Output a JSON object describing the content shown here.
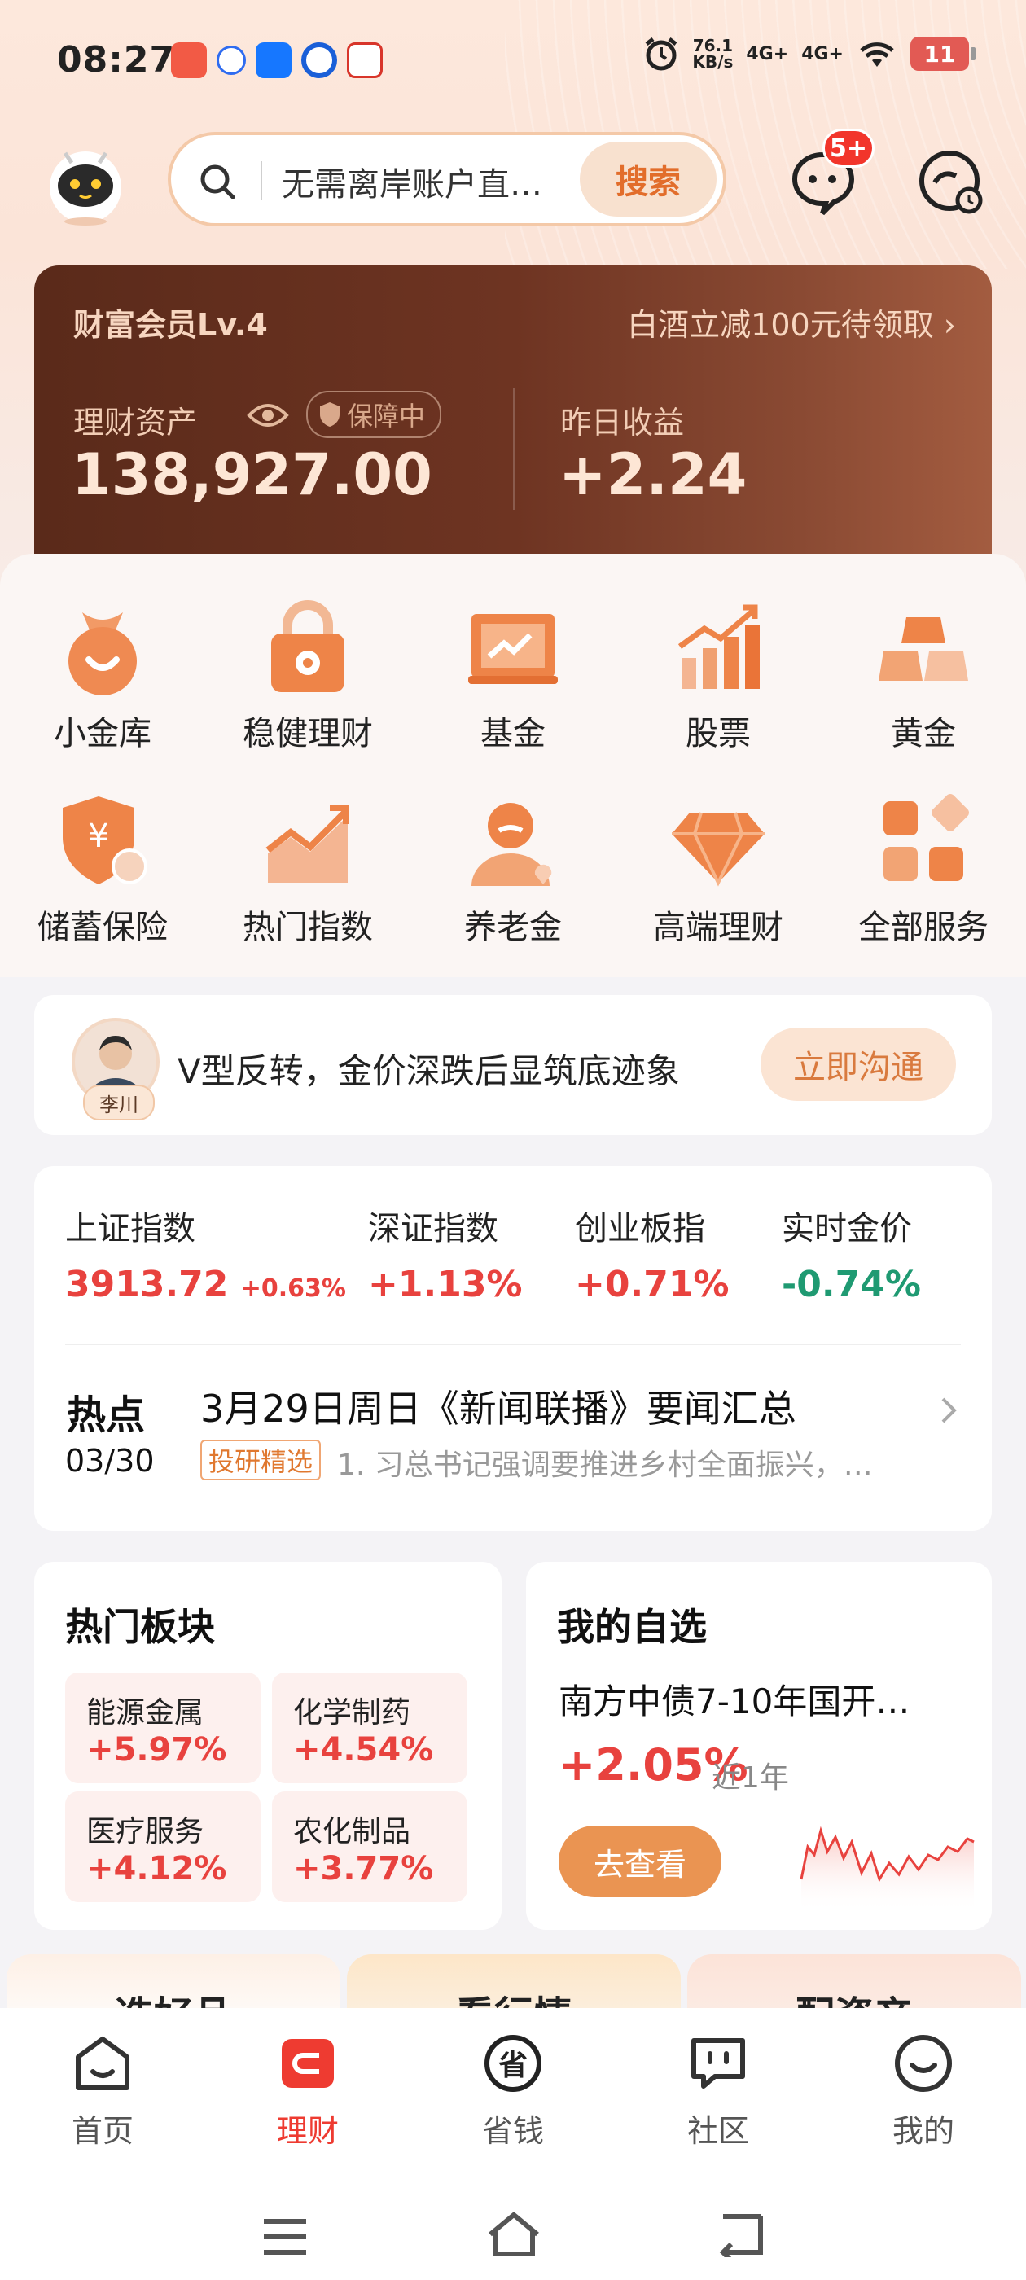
{
  "status_bar": {
    "time": "08:27",
    "net_speed_top": "76.1",
    "net_speed_unit": "KB/s",
    "signal1": "4G+",
    "signal2": "4G+",
    "battery": "11"
  },
  "header": {
    "search_placeholder": "无需离岸账户直…",
    "search_button": "搜索",
    "message_badge": "5+"
  },
  "member_card": {
    "level": "财富会员Lv.4",
    "promo": "白酒立减100元待领取",
    "asset_label": "理财资产",
    "guard_label": "保障中",
    "asset_value": "138,927.00",
    "yesterday_label": "昨日收益",
    "yesterday_value": "+2.24"
  },
  "services": [
    {
      "label": "小金库",
      "icon": "bag-icon"
    },
    {
      "label": "稳健理财",
      "icon": "lock-icon"
    },
    {
      "label": "基金",
      "icon": "board-icon"
    },
    {
      "label": "股票",
      "icon": "bar-chart-icon"
    },
    {
      "label": "黄金",
      "icon": "gold-bars-icon"
    },
    {
      "label": "储蓄保险",
      "icon": "shield-yen-icon"
    },
    {
      "label": "热门指数",
      "icon": "trend-icon"
    },
    {
      "label": "养老金",
      "icon": "elder-icon"
    },
    {
      "label": "高端理财",
      "icon": "diamond-icon"
    },
    {
      "label": "全部服务",
      "icon": "grid-icon"
    }
  ],
  "advisor": {
    "name": "李川",
    "message": "V型反转，金价深跌后显筑底迹象",
    "button": "立即沟通"
  },
  "market": {
    "indices": [
      {
        "name": "上证指数",
        "value": "3913.72",
        "change": "+0.63%"
      },
      {
        "name": "深证指数",
        "value": "+1.13%"
      },
      {
        "name": "创业板指",
        "value": "+0.71%"
      },
      {
        "name": "实时金价",
        "value": "-0.74%"
      }
    ],
    "hot_label": "热点",
    "hot_date": "03/30",
    "news_title": "3月29日周日《新闻联播》要闻汇总",
    "news_tag": "投研精选",
    "news_sub": "1. 习总书记强调要推进乡村全面振兴，…"
  },
  "sectors": {
    "title": "热门板块",
    "items": [
      {
        "name": "能源金属",
        "change": "+5.97%"
      },
      {
        "name": "化学制药",
        "change": "+4.54%"
      },
      {
        "name": "医疗服务",
        "change": "+4.12%"
      },
      {
        "name": "农化制品",
        "change": "+3.77%"
      }
    ]
  },
  "watchlist": {
    "title": "我的自选",
    "fund_name": "南方中债7-10年国开…",
    "return": "+2.05%",
    "period": "近1年",
    "button": "去查看"
  },
  "peek_tabs": [
    "选好品",
    "看行情",
    "配资产"
  ],
  "nav": [
    {
      "label": "首页",
      "icon": "home-icon"
    },
    {
      "label": "理财",
      "icon": "wallet-icon"
    },
    {
      "label": "省钱",
      "icon": "save-icon"
    },
    {
      "label": "社区",
      "icon": "community-icon"
    },
    {
      "label": "我的",
      "icon": "smile-icon"
    }
  ],
  "colors": {
    "accent": "#ee3b31",
    "up": "#e8423e",
    "down": "#1f9a72",
    "orange": "#ea9452",
    "card_brown": "#5a2a1a"
  }
}
